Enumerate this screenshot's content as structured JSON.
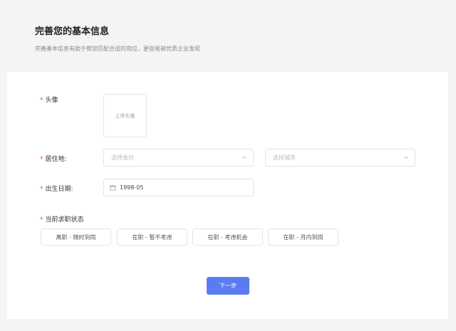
{
  "header": {
    "title": "完善您的基本信息",
    "subtitle": "完善基本信息有助于帮您匹配合适的岗位，更容易被优质企业发现"
  },
  "form": {
    "avatar": {
      "label": "头像",
      "required_mark": "*",
      "upload_text": "上传头像"
    },
    "residence": {
      "label": "居住地:",
      "required_mark": "*",
      "province_placeholder": "选择省份",
      "city_placeholder": "选择城市"
    },
    "birth": {
      "label": "出生日期:",
      "required_mark": "*",
      "value": "1998-05"
    },
    "job_status": {
      "label": "当前求职状态",
      "required_mark": "*",
      "options": [
        "离职 - 随时到岗",
        "在职 - 暂不考虑",
        "在职 - 考虑机会",
        "在职 - 月内到岗"
      ]
    },
    "next_label": "下一步"
  },
  "colors": {
    "primary": "#5b7cf0",
    "required": "#f04a4a",
    "background": "#f3f4f6"
  }
}
